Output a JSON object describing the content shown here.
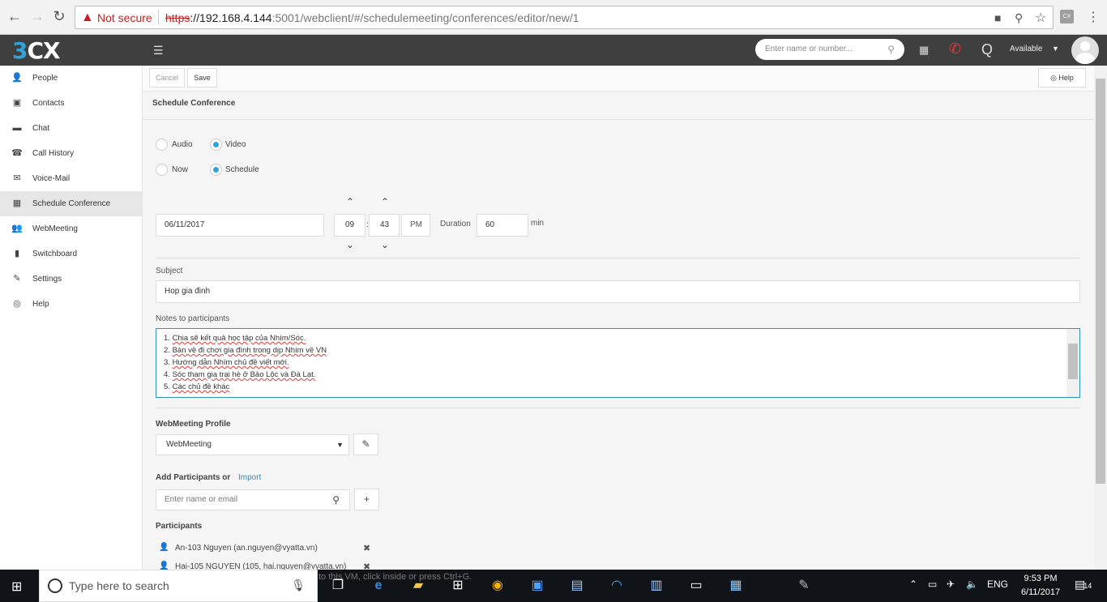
{
  "browser": {
    "not_secure": "Not secure",
    "url_proto": "https",
    "url_host": "://192.168.4.144",
    "url_path": ":5001/webclient/#/schedulemeeting/conferences/editor/new/1",
    "ext_label": "CX"
  },
  "header": {
    "logo_a": "3",
    "logo_b": "CX",
    "search_placeholder": "Enter name or number...",
    "status": "Available",
    "q_label": "Q"
  },
  "sidebar": {
    "items": [
      {
        "label": "People",
        "icon": "person-icon"
      },
      {
        "label": "Contacts",
        "icon": "contacts-icon"
      },
      {
        "label": "Chat",
        "icon": "chat-icon"
      },
      {
        "label": "Call History",
        "icon": "phone-icon"
      },
      {
        "label": "Voice-Mail",
        "icon": "mail-icon"
      },
      {
        "label": "Schedule Conference",
        "icon": "calendar-icon"
      },
      {
        "label": "WebMeeting",
        "icon": "group-icon"
      },
      {
        "label": "Switchboard",
        "icon": "bar-chart-icon"
      },
      {
        "label": "Settings",
        "icon": "wrench-icon"
      },
      {
        "label": "Help",
        "icon": "lifebuoy-icon"
      }
    ],
    "active_index": 5
  },
  "toolbar": {
    "cancel": "Cancel",
    "save": "Save",
    "help": "Help"
  },
  "page": {
    "title": "Schedule Conference",
    "radio_audio": "Audio",
    "radio_video": "Video",
    "radio_now": "Now",
    "radio_schedule": "Schedule",
    "date": "06/11/2017",
    "hour": "09",
    "time_sep": ":",
    "minute": "43",
    "ampm": "PM",
    "duration_label": "Duration",
    "duration": "60",
    "min_label": "min",
    "subject_label": "Subject",
    "subject": "Hop gia đinh",
    "notes_label": "Notes to participants",
    "notes": [
      {
        "num": "1.",
        "text": "Chia sẽ kết quả học tập của Nhím/Sóc."
      },
      {
        "num": "2.",
        "text": " Bàn về đi chơi gia đình trong dịp Nhím về VN"
      },
      {
        "num": "3.",
        "text": "Hướng dẫn Nhím chủ đề viết mới."
      },
      {
        "num": "4.",
        "text": "Sóc tham gia trại hè ở Bảo Lộc và Đà Lạt."
      },
      {
        "num": "5.",
        "text": "Các chủ đề khác"
      }
    ],
    "profile_title": "WebMeeting Profile",
    "profile_value": "WebMeeting",
    "add_title": "Add Participants or",
    "import_link": "Import",
    "add_placeholder": "Enter name or email",
    "participants_title": "Participants",
    "participants": [
      "An-103 Nguyen (an.nguyen@vyatta.vn)",
      "Hai-105 NGUYEN (105, hai.nguyen@vyatta.vn)"
    ]
  },
  "taskbar": {
    "search_placeholder": "Type here to search",
    "vm_note": "to this VM, click inside or press Ctrl+G.",
    "lang": "ENG",
    "time": "9:53 PM",
    "date": "6/11/2017",
    "notif_count": "14"
  }
}
